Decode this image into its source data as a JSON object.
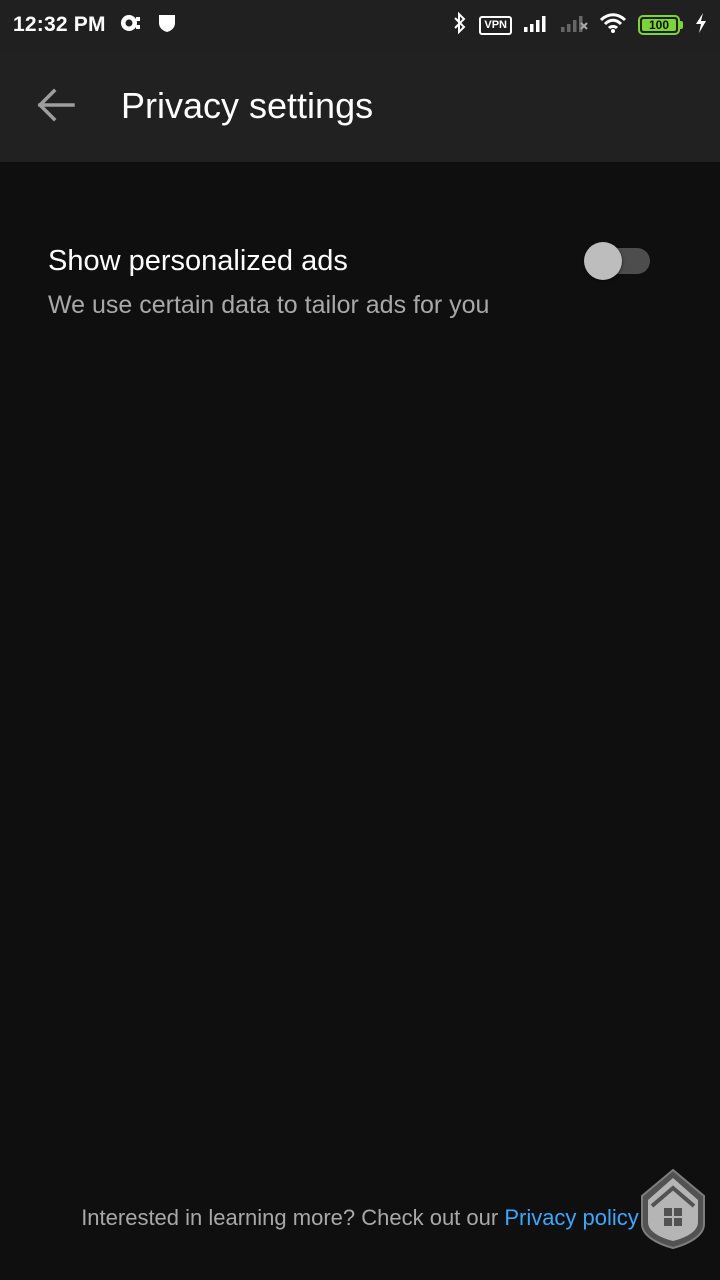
{
  "status_bar": {
    "time": "12:32 PM",
    "vpn_label": "VPN",
    "battery_level": "100",
    "battery_color": "#7cd43a",
    "icons": [
      "notification-icon",
      "shield-icon",
      "bluetooth-icon",
      "signal-icon",
      "signal-off-icon",
      "wifi-icon",
      "charging-icon"
    ]
  },
  "app_bar": {
    "title": "Privacy settings",
    "back_icon": "arrow-back-icon"
  },
  "settings": [
    {
      "title": "Show personalized ads",
      "description": "We use certain data to tailor ads for you",
      "enabled": false
    }
  ],
  "footer": {
    "text": "Interested in learning more? Check out our ",
    "link_label": "Privacy policy",
    "link_color": "#3ea6ff"
  },
  "colors": {
    "background": "#0f0f0f",
    "app_bar": "#212121",
    "secondary_text": "#a8a8a8"
  }
}
